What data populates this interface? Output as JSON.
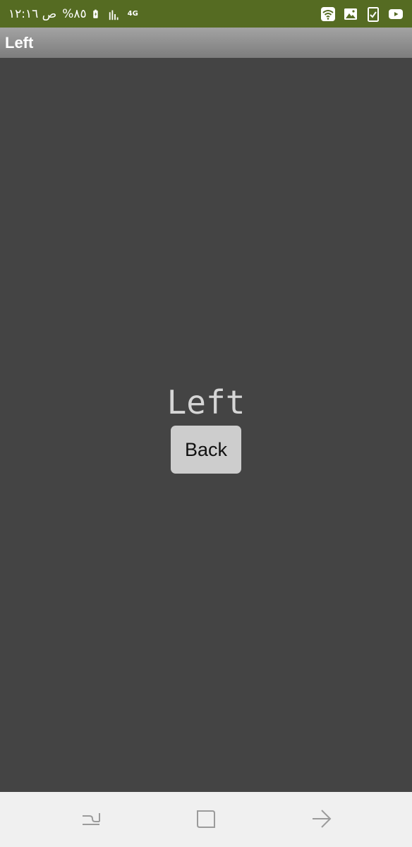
{
  "status_bar": {
    "time": "ص ١٢:١٦",
    "battery": "%٨٥",
    "network_type": "4G",
    "background_color": "#556b22",
    "icons": [
      "charging-battery-icon",
      "signal-icon",
      "network-4g-icon",
      "wifi-icon",
      "gallery-icon",
      "clipboard-check-icon",
      "youtube-icon"
    ]
  },
  "app_bar": {
    "title": "Left"
  },
  "main": {
    "label": "Left",
    "back_button": "Back",
    "background_color": "#444444"
  },
  "nav_bar": {
    "buttons": [
      "recent-apps-icon",
      "home-icon",
      "back-icon"
    ]
  }
}
